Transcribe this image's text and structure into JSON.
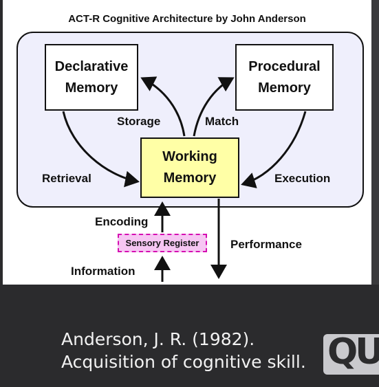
{
  "diagram": {
    "title": "ACT-R  Cognitive Architecture by John Anderson",
    "boxes": {
      "declarative": "Declarative\nMemory",
      "procedural": "Procedural\nMemory",
      "working": "Working\nMemory",
      "sensory": "Sensory Register"
    },
    "labels": {
      "storage": "Storage",
      "match": "Match",
      "retrieval": "Retrieval",
      "execution": "Execution",
      "encoding": "Encoding",
      "performance": "Performance",
      "information": "Information"
    },
    "colors": {
      "panel": "#efeffc",
      "working_fill": "#ffffa6",
      "sensory_fill": "#f6c6f3",
      "sensory_border": "#d50db1"
    }
  },
  "citation": {
    "line1": "Anderson, J. R. (1982).",
    "line2": "Acquisition of cognitive skill."
  },
  "watermark": "QU"
}
